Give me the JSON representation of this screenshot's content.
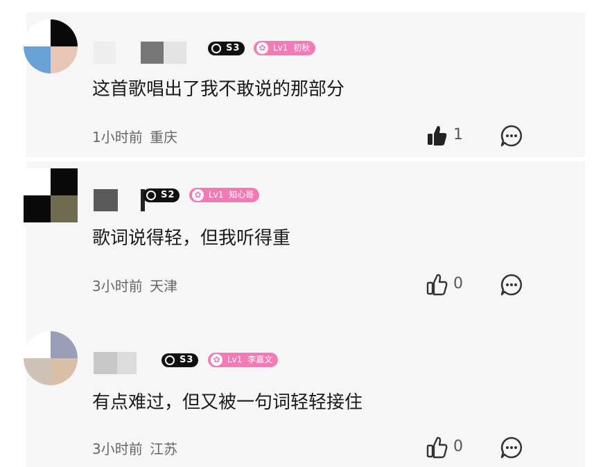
{
  "comments": [
    {
      "text": "这首歌唱出了我不敢说的那部分",
      "time": "1小时前",
      "location": "重庆",
      "ip_badge": "S3",
      "level": "Lv1",
      "title": "初秋",
      "likes": "1",
      "liked": true,
      "avatar_colors": [
        "#ffffff",
        "#0a0a0a",
        "#6aa2d6",
        "#e9c5b6"
      ]
    },
    {
      "text": "歌词说得轻，但我听得重",
      "time": "3小时前",
      "location": "天津",
      "ip_badge": "S2",
      "level": "Lv1",
      "title": "知心哥",
      "likes": "0",
      "liked": false,
      "avatar_colors": [
        "#ffffff",
        "#0a0a0a",
        "#0a0a0a",
        "#6e6b4f"
      ]
    },
    {
      "text": "有点难过，但又被一句词轻轻接住",
      "time": "3小时前",
      "location": "江苏",
      "ip_badge": "S3",
      "level": "Lv1",
      "title": "李嘉文",
      "likes": "0",
      "liked": false,
      "avatar_colors": [
        "#ffffff",
        "#9a9fb7",
        "#cfc2b6",
        "#d9bfa8"
      ]
    }
  ],
  "icons": {
    "like": "thumbs-up-icon",
    "reply": "comment-bubble-icon",
    "level": "star-icon",
    "ip": "ip-badge-icon"
  },
  "colors": {
    "level_badge": "#f47ab7",
    "ip_badge": "#111111"
  }
}
